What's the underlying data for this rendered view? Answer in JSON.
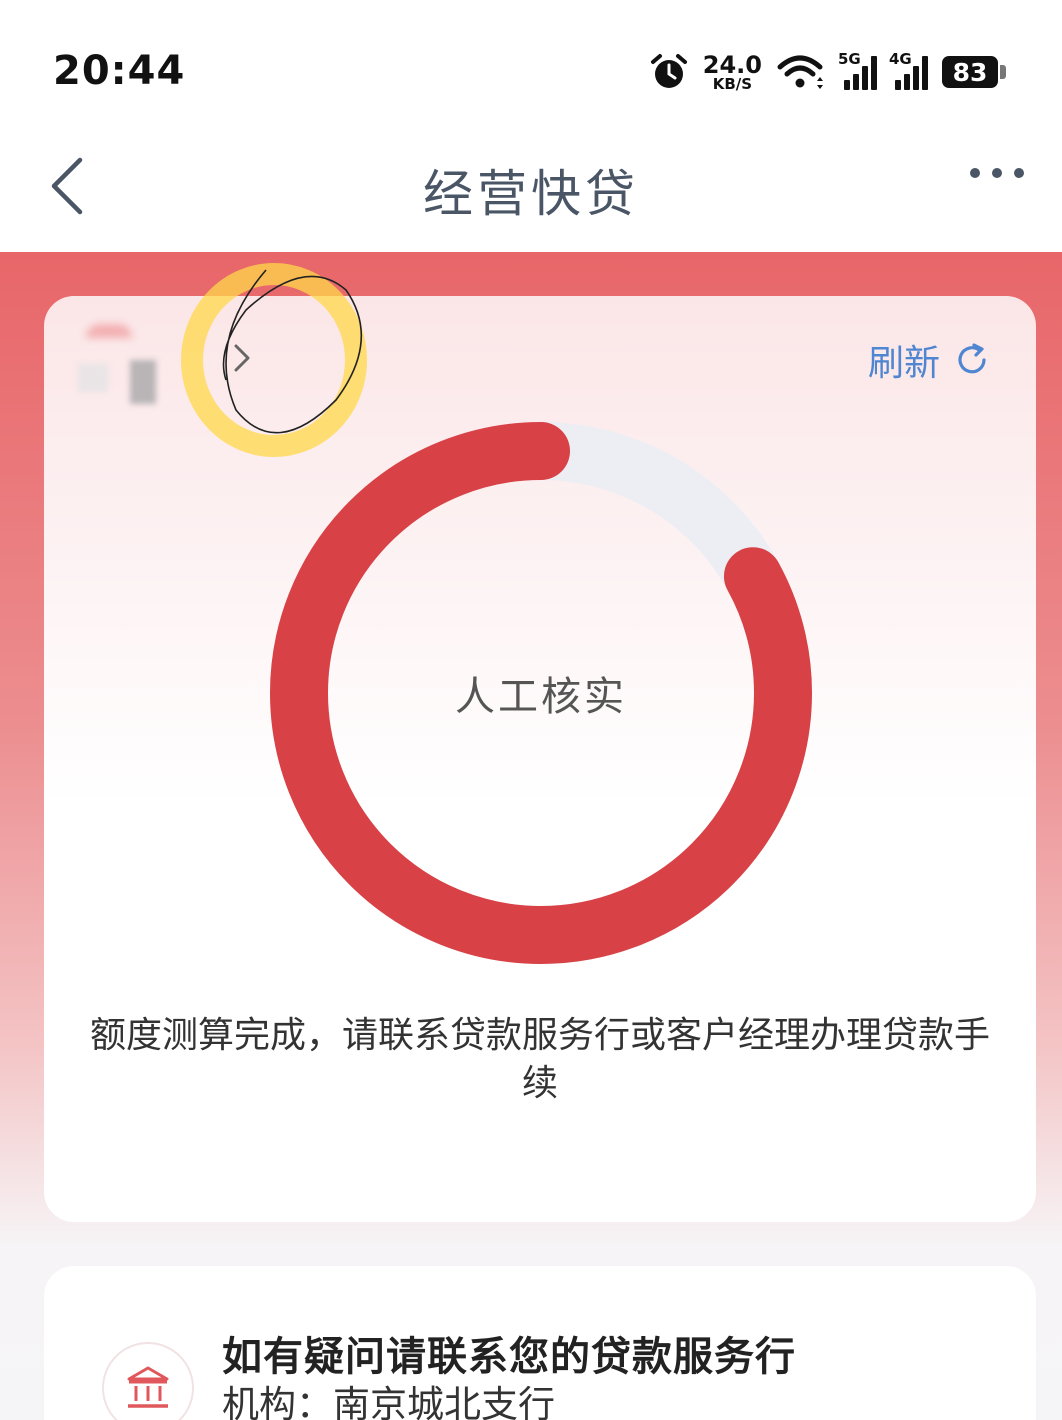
{
  "status_bar": {
    "time": "20:44",
    "net_speed_value": "24.0",
    "net_speed_unit": "KB/S",
    "signal_1_label": "5G",
    "signal_2_label": "4G",
    "battery": "83"
  },
  "navbar": {
    "title": "经营快贷"
  },
  "card": {
    "refresh_label": "刷新",
    "status_text": "人工核实",
    "progress_fraction": 0.83,
    "message": "额度测算完成，请联系贷款服务行或客户经理办理贷款手续",
    "ring_color": "#d84145",
    "ring_track_color": "#eceef3"
  },
  "contact_card": {
    "title": "如有疑问请联系您的贷款服务行",
    "org_label": "机构：",
    "org_value": "南京城北支行"
  },
  "colors": {
    "accent": "#d84145",
    "link": "#4f86d1",
    "title_text": "#4a5666"
  }
}
